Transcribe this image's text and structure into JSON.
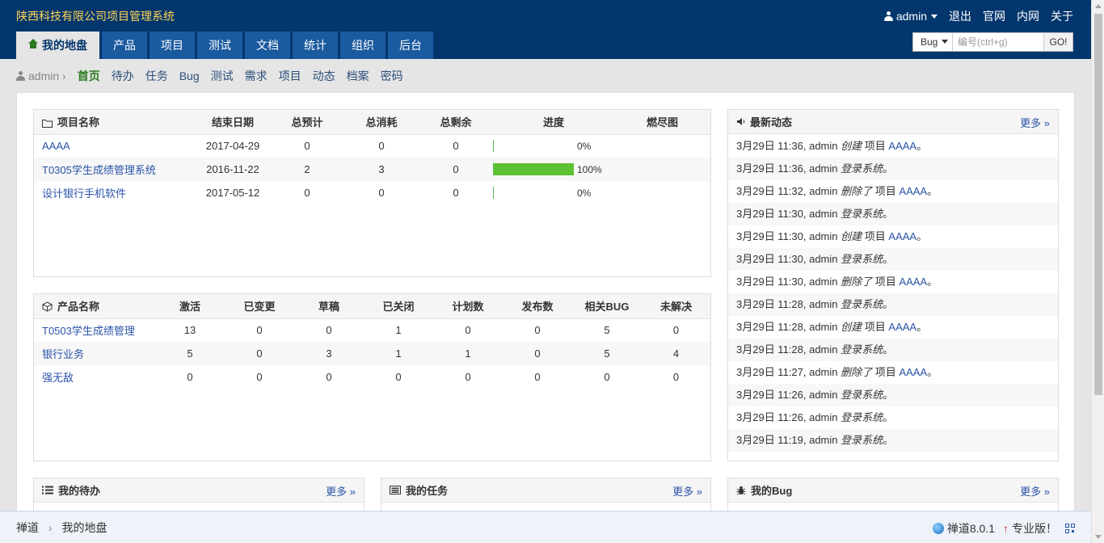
{
  "header": {
    "company": "陕西科技有限公司项目管理系统",
    "user": "admin",
    "links": [
      "退出",
      "官网",
      "内网",
      "关于"
    ]
  },
  "mainnav": {
    "tabs": [
      "我的地盘",
      "产品",
      "项目",
      "测试",
      "文档",
      "统计",
      "组织",
      "后台"
    ]
  },
  "search": {
    "type": "Bug",
    "placeholder": "编号(ctrl+g)",
    "go": "GO!"
  },
  "subnav": {
    "user": "admin",
    "items": [
      "首页",
      "待办",
      "任务",
      "Bug",
      "测试",
      "需求",
      "项目",
      "动态",
      "档案",
      "密码"
    ]
  },
  "projects": {
    "headers": [
      "项目名称",
      "结束日期",
      "总预计",
      "总消耗",
      "总剩余",
      "进度",
      "燃尽图"
    ],
    "rows": [
      {
        "name": "AAAA",
        "end": "2017-04-29",
        "estimate": "0",
        "consumed": "0",
        "left": "0",
        "progress": 0,
        "progress_text": "0%"
      },
      {
        "name": "T0305学生成绩管理系统",
        "end": "2016-11-22",
        "estimate": "2",
        "consumed": "3",
        "left": "0",
        "progress": 100,
        "progress_text": "100%"
      },
      {
        "name": "设计银行手机软件",
        "end": "2017-05-12",
        "estimate": "0",
        "consumed": "0",
        "left": "0",
        "progress": 0,
        "progress_text": "0%"
      }
    ]
  },
  "products": {
    "headers": [
      "产品名称",
      "激活",
      "已变更",
      "草稿",
      "已关闭",
      "计划数",
      "发布数",
      "相关BUG",
      "未解决"
    ],
    "rows": [
      [
        "T0503学生成绩管理",
        "13",
        "0",
        "0",
        "1",
        "0",
        "0",
        "5",
        "0"
      ],
      [
        "银行业务",
        "5",
        "0",
        "3",
        "1",
        "1",
        "0",
        "5",
        "4"
      ],
      [
        "强无敌",
        "0",
        "0",
        "0",
        "0",
        "0",
        "0",
        "0",
        "0"
      ]
    ]
  },
  "dynamics": {
    "title": "最新动态",
    "more": "更多",
    "items": [
      {
        "time": "3月29日 11:36, admin",
        "action": "创建",
        "object": "项目",
        "link": "AAAA",
        "tail": "。"
      },
      {
        "time": "3月29日 11:36, admin",
        "action": "登录系统",
        "object": "",
        "link": "",
        "tail": "。"
      },
      {
        "time": "3月29日 11:32, admin",
        "action": "删除了",
        "object": "项目",
        "link": "AAAA",
        "tail": "。"
      },
      {
        "time": "3月29日 11:30, admin",
        "action": "登录系统",
        "object": "",
        "link": "",
        "tail": "。"
      },
      {
        "time": "3月29日 11:30, admin",
        "action": "创建",
        "object": "项目",
        "link": "AAAA",
        "tail": "。"
      },
      {
        "time": "3月29日 11:30, admin",
        "action": "登录系统",
        "object": "",
        "link": "",
        "tail": "。"
      },
      {
        "time": "3月29日 11:30, admin",
        "action": "删除了",
        "object": "项目",
        "link": "AAAA",
        "tail": "。"
      },
      {
        "time": "3月29日 11:28, admin",
        "action": "登录系统",
        "object": "",
        "link": "",
        "tail": "。"
      },
      {
        "time": "3月29日 11:28, admin",
        "action": "创建",
        "object": "项目",
        "link": "AAAA",
        "tail": "。"
      },
      {
        "time": "3月29日 11:28, admin",
        "action": "登录系统",
        "object": "",
        "link": "",
        "tail": "。"
      },
      {
        "time": "3月29日 11:27, admin",
        "action": "删除了",
        "object": "项目",
        "link": "AAAA",
        "tail": "。"
      },
      {
        "time": "3月29日 11:26, admin",
        "action": "登录系统",
        "object": "",
        "link": "",
        "tail": "。"
      },
      {
        "time": "3月29日 11:26, admin",
        "action": "登录系统",
        "object": "",
        "link": "",
        "tail": "。"
      },
      {
        "time": "3月29日 11:19, admin",
        "action": "登录系统",
        "object": "",
        "link": "",
        "tail": "。"
      }
    ]
  },
  "bottom_panels": {
    "todo": {
      "title": "我的待办",
      "more": "更多"
    },
    "task": {
      "title": "我的任务",
      "more": "更多"
    },
    "bug": {
      "title": "我的Bug",
      "more": "更多"
    }
  },
  "footer": {
    "crumbs": [
      "禅道",
      "我的地盘"
    ],
    "version": "禅道8.0.1",
    "pro": "专业版！"
  },
  "colors": {
    "header_bg": "#03366d",
    "company_text": "#ffd455",
    "tab_bg": "#1a5a9f",
    "progress_fill": "#5ec131",
    "link": "#2a53a8",
    "active_green": "#2b7a20"
  }
}
